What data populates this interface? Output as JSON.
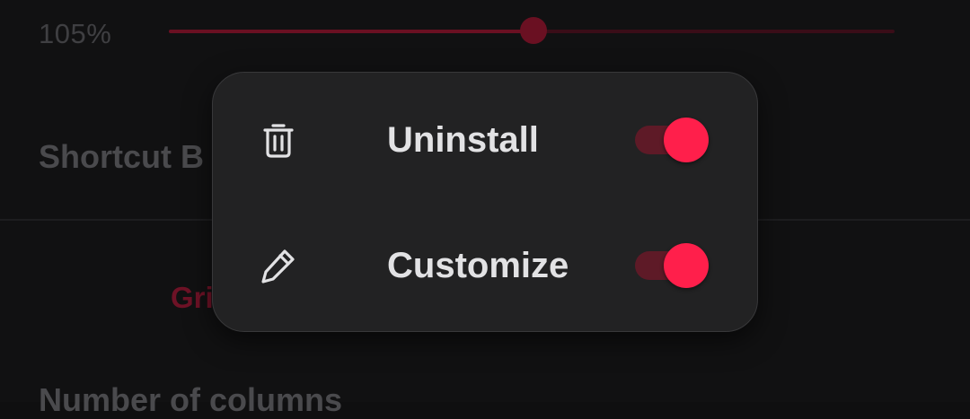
{
  "background": {
    "zoom_value": "105%",
    "zoom_slider_fraction": 0.502,
    "section_label": "Shortcut B",
    "grid_tab_label": "Gri",
    "columns_label": "Number of columns"
  },
  "popup": {
    "items": [
      {
        "label": "Uninstall",
        "icon": "trash-icon",
        "enabled": true
      },
      {
        "label": "Customize",
        "icon": "pencil-icon",
        "enabled": true
      }
    ]
  },
  "colors": {
    "accent": "#ff1f4b",
    "accent_dim": "#6a1022",
    "popup_bg": "#222223",
    "page_bg": "#111112",
    "text_primary": "#e2e2e4"
  }
}
